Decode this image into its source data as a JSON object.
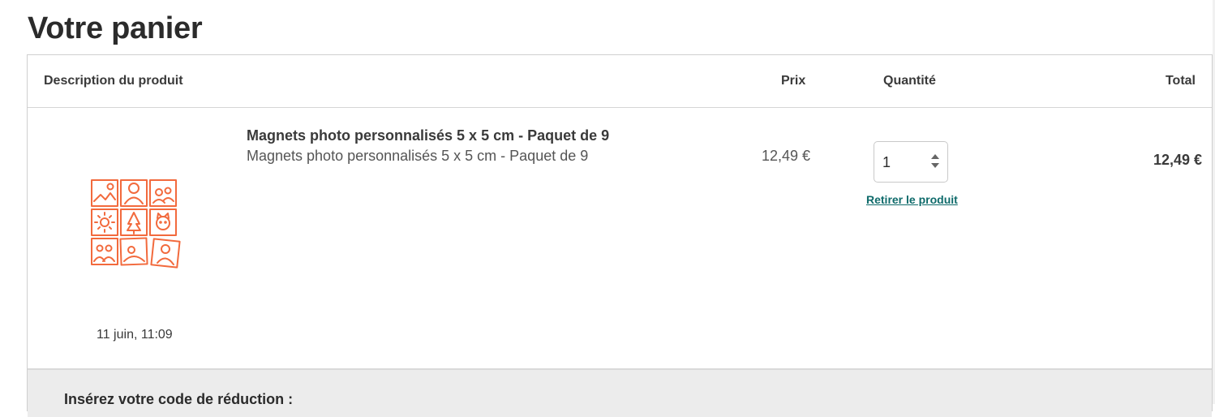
{
  "page": {
    "title": "Votre panier"
  },
  "cart": {
    "headers": {
      "description": "Description du produit",
      "price": "Prix",
      "quantity": "Quantité",
      "total": "Total"
    },
    "items": [
      {
        "name": "Magnets photo personnalisés 5 x 5 cm - Paquet de 9",
        "subtitle": "Magnets photo personnalisés 5 x 5 cm - Paquet de 9",
        "date": "11 juin, 11:09",
        "price": "12,49 €",
        "quantity": "1",
        "remove_label": "Retirer le produit",
        "total": "12,49 €",
        "image_icon": "magnet-grid-icon"
      }
    ]
  },
  "discount": {
    "label": "Insérez votre code de réduction :"
  },
  "colors": {
    "accent_orange": "#f26a3d",
    "link_teal": "#0f6b6b"
  }
}
